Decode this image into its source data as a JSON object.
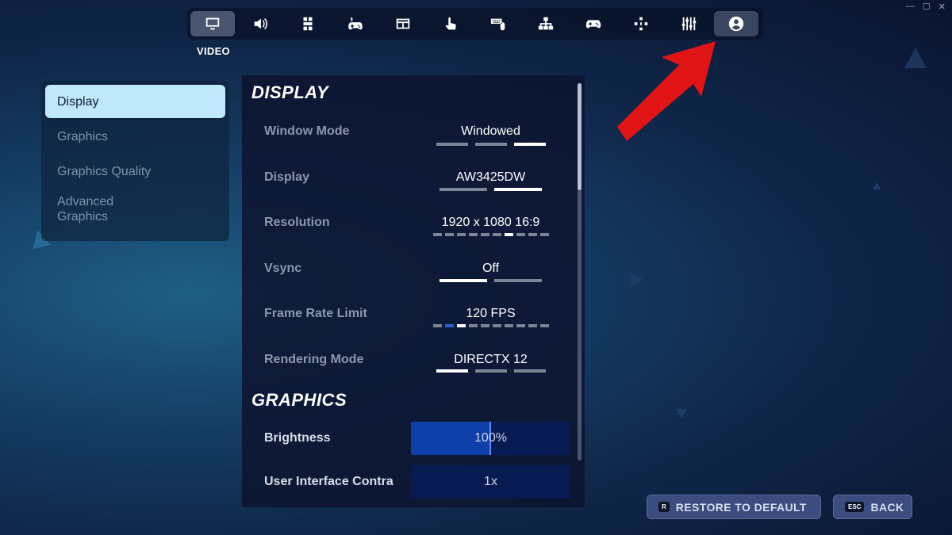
{
  "window_controls": [
    "—",
    "☐",
    "✕"
  ],
  "nav": {
    "tabs": [
      {
        "icon": "monitor-icon",
        "active": true
      },
      {
        "icon": "speaker-icon"
      },
      {
        "icon": "accessibility-icon"
      },
      {
        "icon": "controller-settings-icon"
      },
      {
        "icon": "game-ui-icon"
      },
      {
        "icon": "touch-icon"
      },
      {
        "icon": "keyboard-mouse-icon"
      },
      {
        "icon": "hierarchy-icon"
      },
      {
        "icon": "gamepad-icon"
      },
      {
        "icon": "dpad-icon"
      },
      {
        "icon": "sliders-icon"
      },
      {
        "icon": "account-icon"
      }
    ],
    "active_title": "VIDEO"
  },
  "sidebar": {
    "items": [
      {
        "label": "Display",
        "active": true
      },
      {
        "label": "Graphics"
      },
      {
        "label": "Graphics Quality"
      },
      {
        "label": "Advanced Graphics"
      }
    ]
  },
  "display_section": {
    "title": "DISPLAY",
    "rows": [
      {
        "label": "Window Mode",
        "value": "Windowed",
        "options": 3,
        "selected": 2
      },
      {
        "label": "Display",
        "value": "AW3425DW",
        "options": 2,
        "selected": 1
      },
      {
        "label": "Resolution",
        "value": "1920 x 1080 16:9",
        "options": 10,
        "selected": 6
      },
      {
        "label": "Vsync",
        "value": "Off",
        "options": 2,
        "selected": 0
      },
      {
        "label": "Frame Rate Limit",
        "value": "120 FPS",
        "options": 10,
        "selected": 2
      },
      {
        "label": "Rendering Mode",
        "value": "DIRECTX 12",
        "options": 3,
        "selected": 0
      }
    ]
  },
  "graphics_section": {
    "title": "GRAPHICS",
    "rows": [
      {
        "label": "Brightness",
        "value": "100%",
        "fill": 0.5
      },
      {
        "label": "User Interface Contra",
        "value": "1x",
        "fill": 0
      }
    ]
  },
  "buttons": {
    "restore": {
      "key": "R",
      "label": "RESTORE TO DEFAULT"
    },
    "back": {
      "key": "ESC",
      "label": "BACK"
    }
  },
  "colors": {
    "active_sidebar": "#bfe9fb",
    "slider_fill": "#0e3fa8",
    "arrow": "#e01414"
  }
}
